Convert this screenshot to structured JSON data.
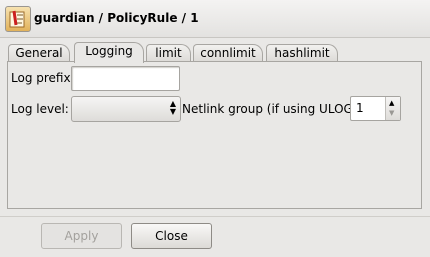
{
  "window": {
    "title": "guardian / PolicyRule / 1"
  },
  "tabs": [
    {
      "label": "General",
      "active": false
    },
    {
      "label": "Logging",
      "active": true
    },
    {
      "label": "limit",
      "active": false
    },
    {
      "label": "connlimit",
      "active": false
    },
    {
      "label": "hashlimit",
      "active": false
    }
  ],
  "logging": {
    "log_prefix_label": "Log prefix:",
    "log_prefix_value": "",
    "log_level_label": "Log level:",
    "log_level_value": "",
    "netlink_label": "Netlink group (if using ULOG):",
    "netlink_value": "1"
  },
  "footer": {
    "apply_label": "Apply",
    "close_label": "Close"
  },
  "icons": {
    "app": "firewall-policy-icon",
    "combo": "up-down-arrows-icon",
    "spin_up": "up-arrow-icon",
    "spin_down": "down-arrow-icon"
  },
  "colors": {
    "background": "#e9e8e6",
    "disabled_text": "#a3a19d"
  }
}
